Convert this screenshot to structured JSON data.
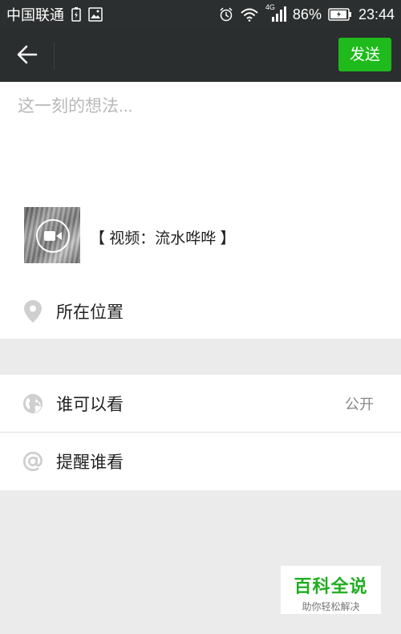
{
  "status_bar": {
    "carrier": "中国联通",
    "network": "4G",
    "battery": "86%",
    "time": "23:44"
  },
  "title_bar": {
    "send_label": "发送"
  },
  "compose": {
    "placeholder": "这一刻的想法...",
    "value": "",
    "video_label": "【 视频：流水哗哗 】",
    "location_label": "所在位置"
  },
  "options": {
    "visibility_label": "谁可以看",
    "visibility_value": "公开",
    "mention_label": "提醒谁看"
  },
  "watermark": {
    "title": "百科全说",
    "subtitle": "助你轻松解决"
  },
  "colors": {
    "accent": "#1fba1c",
    "title_bar_bg": "#2b2e2e",
    "page_bg": "#ebebeb"
  },
  "icons": {
    "back": "arrow-left-icon",
    "location": "location-pin-icon",
    "globe": "globe-icon",
    "mention": "at-sign-icon",
    "video": "video-camera-icon"
  }
}
